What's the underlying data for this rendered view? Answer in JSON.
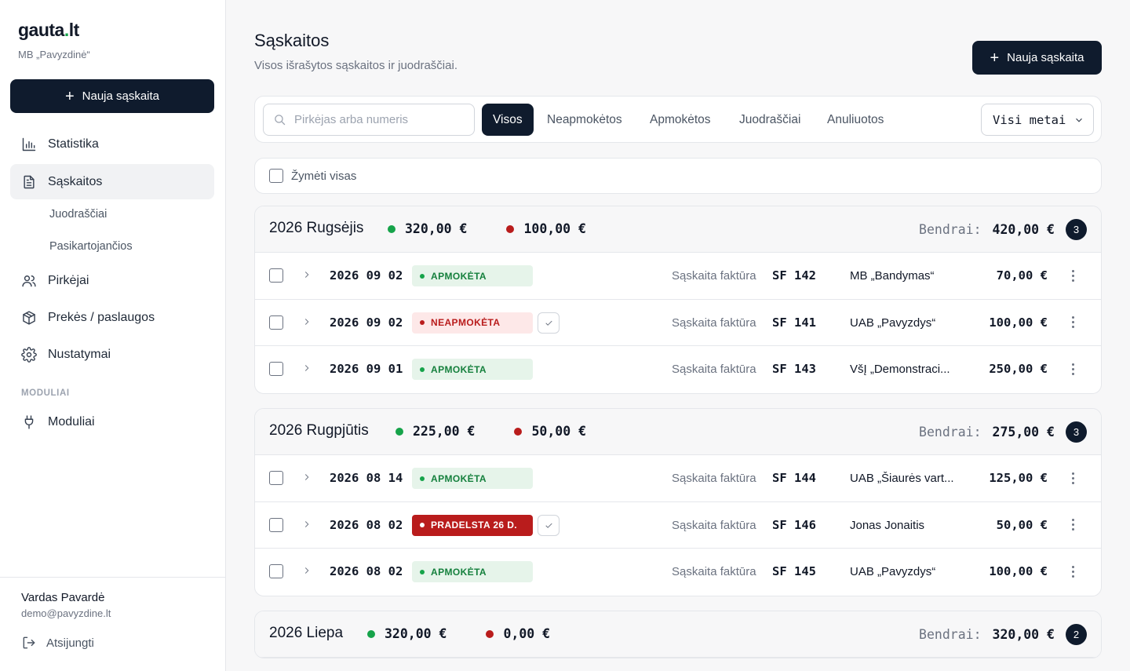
{
  "sidebar": {
    "brand_name": "gauta",
    "brand_dot": ".",
    "brand_tld": "lt",
    "company": "MB „Pavyzdinė“",
    "new_invoice_label": "Nauja sąskaita",
    "nav": {
      "statistics": "Statistika",
      "invoices": "Sąskaitos",
      "drafts": "Juodraščiai",
      "recurring": "Pasikartojančios",
      "buyers": "Pirkėjai",
      "products": "Prekės / paslaugos",
      "settings": "Nustatymai"
    },
    "section_modules": "MODULIAI",
    "modules": "Moduliai",
    "user_name": "Vardas Pavardė",
    "user_email": "demo@pavyzdine.lt",
    "logout": "Atsijungti"
  },
  "header": {
    "title": "Sąskaitos",
    "subtitle": "Visos išrašytos sąskaitos ir juodraščiai.",
    "new_invoice_label": "Nauja sąskaita"
  },
  "filters": {
    "search_placeholder": "Pirkėjas arba numeris",
    "tabs": [
      "Visos",
      "Neapmokėtos",
      "Apmokėtos",
      "Juodraščiai",
      "Anuliuotos"
    ],
    "active_tab": "Visos",
    "year_select": "Visi metai"
  },
  "select_all_label": "Žymėti visas",
  "total_label": "Bendrai:",
  "groups": [
    {
      "title": "2026 Rugsėjis",
      "paid": "320,00 €",
      "unpaid": "100,00 €",
      "total": "420,00 €",
      "count": "3",
      "rows": [
        {
          "date": "2026 09 02",
          "status": "APMOKĖTA",
          "kind": "paid",
          "type": "Sąskaita faktūra",
          "number": "SF 142",
          "buyer": "MB „Bandymas“",
          "amount": "70,00 €"
        },
        {
          "date": "2026 09 02",
          "status": "NEAPMOKĖTA",
          "kind": "unpaid",
          "type": "Sąskaita faktūra",
          "number": "SF 141",
          "buyer": "UAB „Pavyzdys“",
          "amount": "100,00 €"
        },
        {
          "date": "2026 09 01",
          "status": "APMOKĖTA",
          "kind": "paid",
          "type": "Sąskaita faktūra",
          "number": "SF 143",
          "buyer": "VšĮ „Demonstraci...",
          "amount": "250,00 €"
        }
      ]
    },
    {
      "title": "2026 Rugpjūtis",
      "paid": "225,00 €",
      "unpaid": "50,00 €",
      "total": "275,00 €",
      "count": "3",
      "rows": [
        {
          "date": "2026 08 14",
          "status": "APMOKĖTA",
          "kind": "paid",
          "type": "Sąskaita faktūra",
          "number": "SF 144",
          "buyer": "UAB „Šiaurės vart...",
          "amount": "125,00 €"
        },
        {
          "date": "2026 08 02",
          "status": "PRADELSTA 26 D.",
          "kind": "overdue",
          "type": "Sąskaita faktūra",
          "number": "SF 146",
          "buyer": "Jonas Jonaitis",
          "amount": "50,00 €"
        },
        {
          "date": "2026 08 02",
          "status": "APMOKĖTA",
          "kind": "paid",
          "type": "Sąskaita faktūra",
          "number": "SF 145",
          "buyer": "UAB „Pavyzdys“",
          "amount": "100,00 €"
        }
      ]
    },
    {
      "title": "2026 Liepa",
      "paid": "320,00 €",
      "unpaid": "0,00 €",
      "total": "320,00 €",
      "count": "2",
      "rows": []
    }
  ],
  "colors": {
    "primary": "#0f1b2d",
    "paid": "#16a34a",
    "unpaid": "#b91c1c"
  }
}
